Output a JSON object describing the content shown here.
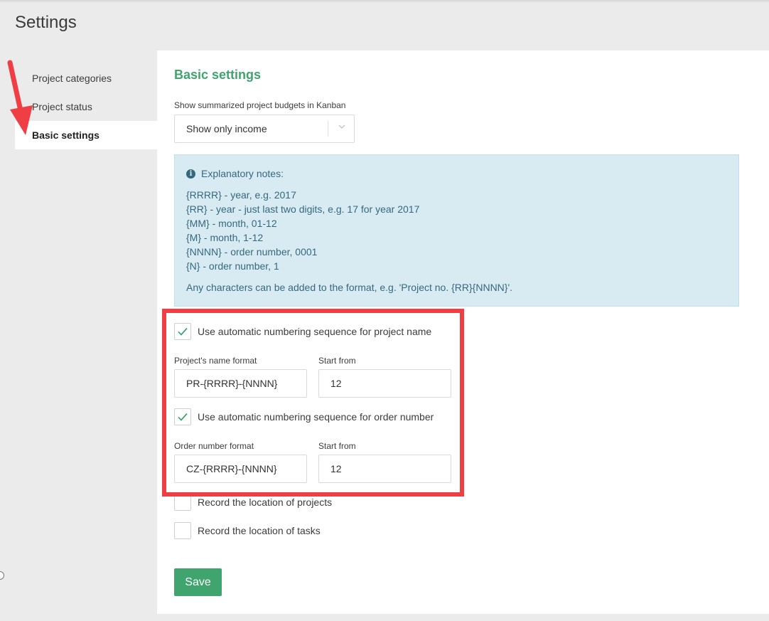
{
  "page": {
    "title": "Settings"
  },
  "sidebar": {
    "items": [
      {
        "label": "Project categories"
      },
      {
        "label": "Project status"
      },
      {
        "label": "Basic settings",
        "active": true
      }
    ]
  },
  "main": {
    "section_title": "Basic settings",
    "budget_select": {
      "label": "Show summarized project budgets in Kanban",
      "value": "Show only income"
    },
    "notes": {
      "title": "Explanatory notes:",
      "lines": [
        "{RRRR} - year, e.g. 2017",
        "{RR} - year - just last two digits, e.g. 17 for year 2017",
        "{MM} - month, 01-12",
        "{M} - month, 1-12",
        "{NNNN} - order number, 0001",
        "{N} - order number, 1"
      ],
      "footer": "Any characters can be added to the format, e.g. 'Project no. {RR}{NNNN}'."
    },
    "project_numbering": {
      "checkbox_label": "Use automatic numbering sequence for project name",
      "checked": true,
      "format_label": "Project's name format",
      "format_value": "PR-{RRRR}-{NNNN}",
      "start_label": "Start from",
      "start_value": "12"
    },
    "order_numbering": {
      "checkbox_label": "Use automatic numbering sequence for order number",
      "checked": true,
      "format_label": "Order number format",
      "format_value": "CZ-{RRRR}-{NNNN}",
      "start_label": "Start from",
      "start_value": "12"
    },
    "location_projects": {
      "label": "Record the location of projects",
      "checked": false
    },
    "location_tasks": {
      "label": "Record the location of tasks",
      "checked": false
    },
    "save_label": "Save"
  },
  "colors": {
    "accent": "#3fa46e",
    "highlight": "#f03e45",
    "notes_bg": "#d8ebf3",
    "notes_text": "#35687e"
  }
}
